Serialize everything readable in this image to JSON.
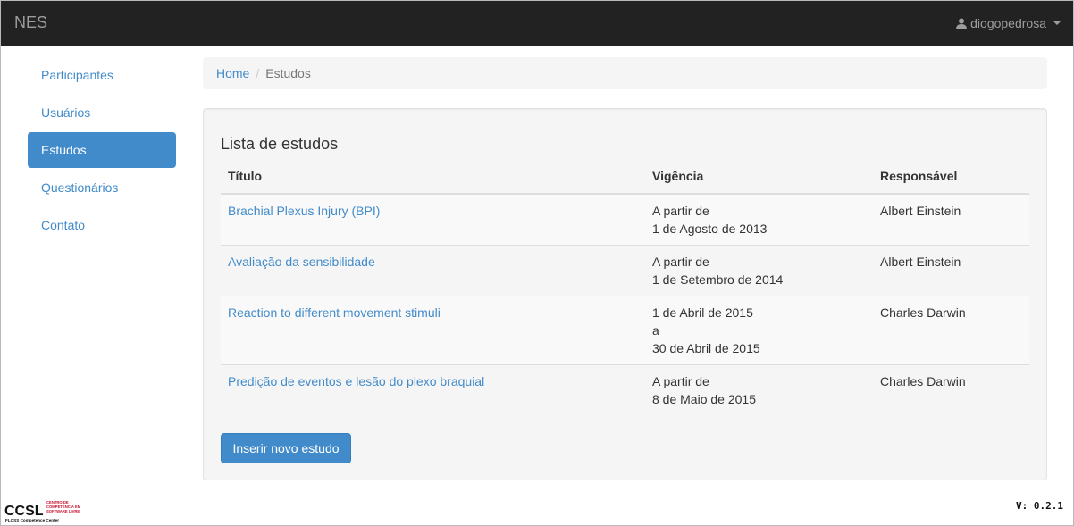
{
  "navbar": {
    "brand": "NES",
    "user": "diogopedrosa"
  },
  "sidebar": {
    "items": [
      {
        "label": "Participantes"
      },
      {
        "label": "Usuários"
      },
      {
        "label": "Estudos",
        "active": true
      },
      {
        "label": "Questionários"
      },
      {
        "label": "Contato"
      }
    ]
  },
  "breadcrumb": {
    "home": "Home",
    "separator": "/",
    "current": "Estudos"
  },
  "main": {
    "title": "Lista de estudos",
    "columns": [
      "Título",
      "Vigência",
      "Responsável"
    ],
    "rows": [
      {
        "title": "Brachial Plexus Injury (BPI)",
        "vig1": "A partir de",
        "vig2": "1 de Agosto de 2013",
        "vig3": "",
        "resp": "Albert Einstein"
      },
      {
        "title": "Avaliação da sensibilidade",
        "vig1": "A partir de",
        "vig2": "1 de Setembro de 2014",
        "vig3": "",
        "resp": "Albert Einstein"
      },
      {
        "title": "Reaction to different movement stimuli",
        "vig1": "1 de Abril de 2015",
        "vig2": "a",
        "vig3": "30 de Abril de 2015",
        "resp": "Charles Darwin"
      },
      {
        "title": "Predição de eventos e lesão do plexo braquial",
        "vig1": "A partir de",
        "vig2": "8 de Maio de 2015",
        "vig3": "",
        "resp": "Charles Darwin"
      }
    ],
    "insert_button": "Inserir novo estudo"
  },
  "footer": {
    "logo": {
      "abbr": "CCSL",
      "line1": "CENTRO DE",
      "line2": "COMPETÊNCIA EM",
      "line3": "SOFTWARE LIVRE",
      "line4": "FLOSS Competence Center"
    },
    "version": "V: 0.2.1"
  },
  "colors": {
    "navbar_bg": "#222222",
    "accent": "#428bca",
    "logo_red": "#c8102e"
  }
}
